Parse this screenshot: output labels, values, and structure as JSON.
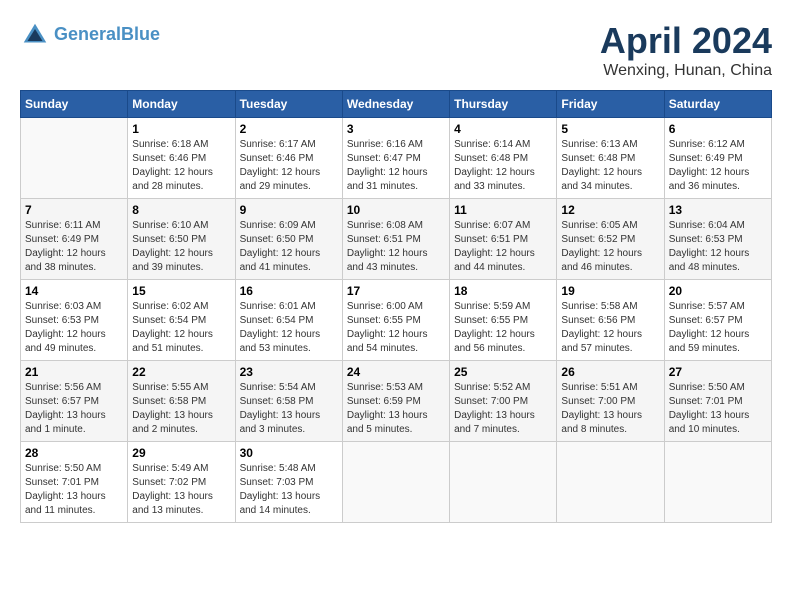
{
  "header": {
    "logo_line1": "General",
    "logo_line2": "Blue",
    "month_title": "April 2024",
    "location": "Wenxing, Hunan, China"
  },
  "calendar": {
    "days_of_week": [
      "Sunday",
      "Monday",
      "Tuesday",
      "Wednesday",
      "Thursday",
      "Friday",
      "Saturday"
    ],
    "weeks": [
      [
        {
          "day": "",
          "info": ""
        },
        {
          "day": "1",
          "info": "Sunrise: 6:18 AM\nSunset: 6:46 PM\nDaylight: 12 hours\nand 28 minutes."
        },
        {
          "day": "2",
          "info": "Sunrise: 6:17 AM\nSunset: 6:46 PM\nDaylight: 12 hours\nand 29 minutes."
        },
        {
          "day": "3",
          "info": "Sunrise: 6:16 AM\nSunset: 6:47 PM\nDaylight: 12 hours\nand 31 minutes."
        },
        {
          "day": "4",
          "info": "Sunrise: 6:14 AM\nSunset: 6:48 PM\nDaylight: 12 hours\nand 33 minutes."
        },
        {
          "day": "5",
          "info": "Sunrise: 6:13 AM\nSunset: 6:48 PM\nDaylight: 12 hours\nand 34 minutes."
        },
        {
          "day": "6",
          "info": "Sunrise: 6:12 AM\nSunset: 6:49 PM\nDaylight: 12 hours\nand 36 minutes."
        }
      ],
      [
        {
          "day": "7",
          "info": "Sunrise: 6:11 AM\nSunset: 6:49 PM\nDaylight: 12 hours\nand 38 minutes."
        },
        {
          "day": "8",
          "info": "Sunrise: 6:10 AM\nSunset: 6:50 PM\nDaylight: 12 hours\nand 39 minutes."
        },
        {
          "day": "9",
          "info": "Sunrise: 6:09 AM\nSunset: 6:50 PM\nDaylight: 12 hours\nand 41 minutes."
        },
        {
          "day": "10",
          "info": "Sunrise: 6:08 AM\nSunset: 6:51 PM\nDaylight: 12 hours\nand 43 minutes."
        },
        {
          "day": "11",
          "info": "Sunrise: 6:07 AM\nSunset: 6:51 PM\nDaylight: 12 hours\nand 44 minutes."
        },
        {
          "day": "12",
          "info": "Sunrise: 6:05 AM\nSunset: 6:52 PM\nDaylight: 12 hours\nand 46 minutes."
        },
        {
          "day": "13",
          "info": "Sunrise: 6:04 AM\nSunset: 6:53 PM\nDaylight: 12 hours\nand 48 minutes."
        }
      ],
      [
        {
          "day": "14",
          "info": "Sunrise: 6:03 AM\nSunset: 6:53 PM\nDaylight: 12 hours\nand 49 minutes."
        },
        {
          "day": "15",
          "info": "Sunrise: 6:02 AM\nSunset: 6:54 PM\nDaylight: 12 hours\nand 51 minutes."
        },
        {
          "day": "16",
          "info": "Sunrise: 6:01 AM\nSunset: 6:54 PM\nDaylight: 12 hours\nand 53 minutes."
        },
        {
          "day": "17",
          "info": "Sunrise: 6:00 AM\nSunset: 6:55 PM\nDaylight: 12 hours\nand 54 minutes."
        },
        {
          "day": "18",
          "info": "Sunrise: 5:59 AM\nSunset: 6:55 PM\nDaylight: 12 hours\nand 56 minutes."
        },
        {
          "day": "19",
          "info": "Sunrise: 5:58 AM\nSunset: 6:56 PM\nDaylight: 12 hours\nand 57 minutes."
        },
        {
          "day": "20",
          "info": "Sunrise: 5:57 AM\nSunset: 6:57 PM\nDaylight: 12 hours\nand 59 minutes."
        }
      ],
      [
        {
          "day": "21",
          "info": "Sunrise: 5:56 AM\nSunset: 6:57 PM\nDaylight: 13 hours\nand 1 minute."
        },
        {
          "day": "22",
          "info": "Sunrise: 5:55 AM\nSunset: 6:58 PM\nDaylight: 13 hours\nand 2 minutes."
        },
        {
          "day": "23",
          "info": "Sunrise: 5:54 AM\nSunset: 6:58 PM\nDaylight: 13 hours\nand 3 minutes."
        },
        {
          "day": "24",
          "info": "Sunrise: 5:53 AM\nSunset: 6:59 PM\nDaylight: 13 hours\nand 5 minutes."
        },
        {
          "day": "25",
          "info": "Sunrise: 5:52 AM\nSunset: 7:00 PM\nDaylight: 13 hours\nand 7 minutes."
        },
        {
          "day": "26",
          "info": "Sunrise: 5:51 AM\nSunset: 7:00 PM\nDaylight: 13 hours\nand 8 minutes."
        },
        {
          "day": "27",
          "info": "Sunrise: 5:50 AM\nSunset: 7:01 PM\nDaylight: 13 hours\nand 10 minutes."
        }
      ],
      [
        {
          "day": "28",
          "info": "Sunrise: 5:50 AM\nSunset: 7:01 PM\nDaylight: 13 hours\nand 11 minutes."
        },
        {
          "day": "29",
          "info": "Sunrise: 5:49 AM\nSunset: 7:02 PM\nDaylight: 13 hours\nand 13 minutes."
        },
        {
          "day": "30",
          "info": "Sunrise: 5:48 AM\nSunset: 7:03 PM\nDaylight: 13 hours\nand 14 minutes."
        },
        {
          "day": "",
          "info": ""
        },
        {
          "day": "",
          "info": ""
        },
        {
          "day": "",
          "info": ""
        },
        {
          "day": "",
          "info": ""
        }
      ]
    ]
  }
}
